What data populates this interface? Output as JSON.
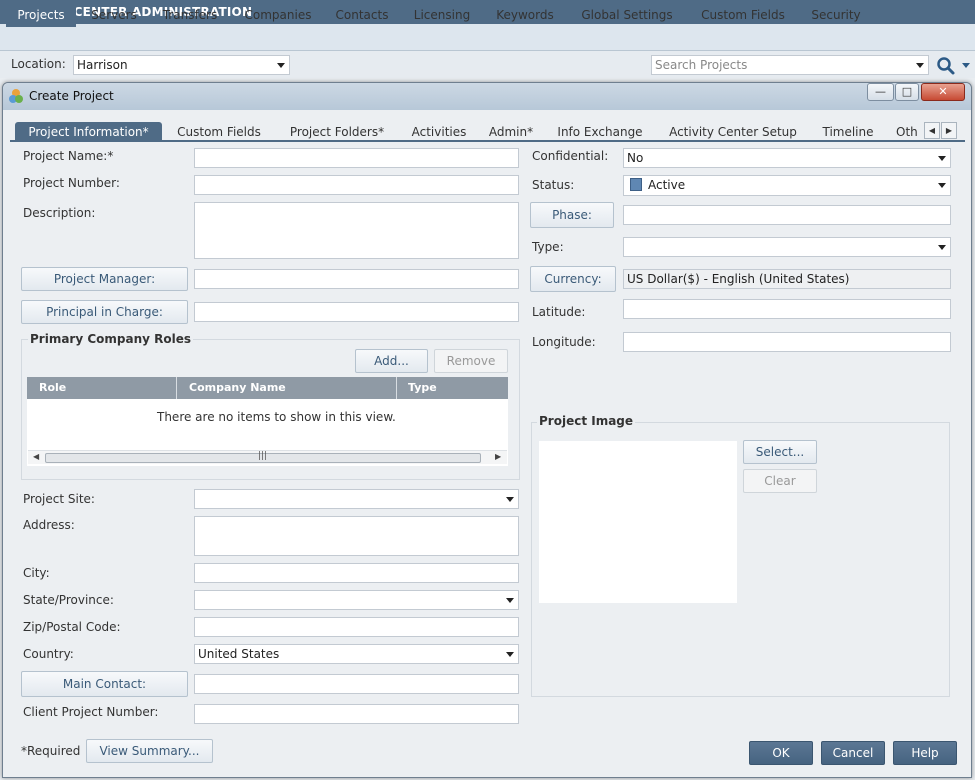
{
  "app": {
    "title": "PROJECT CENTER ADMINISTRATION",
    "nav_tabs": [
      "Projects",
      "Servers",
      "Transfers",
      "Companies",
      "Contacts",
      "Licensing",
      "Keywords",
      "Global Settings",
      "Custom Fields",
      "Security"
    ],
    "active_tab": "Projects"
  },
  "location": {
    "label": "Location:",
    "value": "Harrison",
    "search_placeholder": "Search Projects"
  },
  "dialog": {
    "title": "Create Project",
    "tabs": [
      "Project Information*",
      "Custom Fields",
      "Project Folders*",
      "Activities",
      "Admin*",
      "Info Exchange",
      "Activity Center Setup",
      "Timeline",
      "Oth"
    ],
    "active_tab": "Project Information*",
    "left": {
      "project_name_label": "Project Name:*",
      "project_number_label": "Project Number:",
      "description_label": "Description:",
      "project_manager_btn": "Project Manager:",
      "principal_btn": "Principal in Charge:",
      "roles": {
        "title": "Primary Company Roles",
        "add_btn": "Add...",
        "remove_btn": "Remove",
        "columns": [
          "Role",
          "Company Name",
          "Type"
        ],
        "empty_text": "There are no items to show in this view."
      },
      "project_site_label": "Project Site:",
      "address_label": "Address:",
      "city_label": "City:",
      "state_label": "State/Province:",
      "zip_label": "Zip/Postal Code:",
      "country_label": "Country:",
      "country_value": "United States",
      "main_contact_btn": "Main Contact:",
      "client_number_label": "Client Project Number:"
    },
    "right": {
      "confidential_label": "Confidential:",
      "confidential_value": "No",
      "status_label": "Status:",
      "status_value": "Active",
      "phase_btn": "Phase:",
      "type_label": "Type:",
      "currency_btn": "Currency:",
      "currency_value": "US Dollar($) - English (United States)",
      "latitude_label": "Latitude:",
      "longitude_label": "Longitude:",
      "image": {
        "title": "Project Image",
        "select_btn": "Select...",
        "clear_btn": "Clear"
      }
    },
    "footer": {
      "required_note": "*Required",
      "view_summary_btn": "View Summary...",
      "ok_btn": "OK",
      "cancel_btn": "Cancel",
      "help_btn": "Help"
    }
  }
}
